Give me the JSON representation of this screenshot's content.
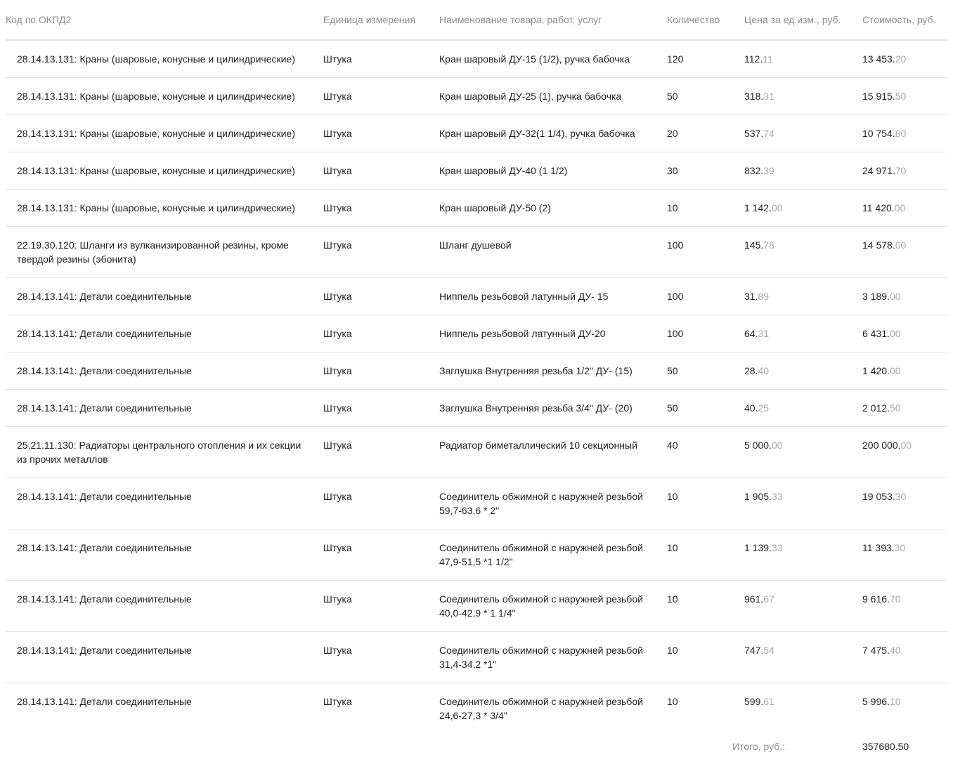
{
  "table": {
    "headers": [
      "Код по ОКПД2",
      "Единица измерения",
      "Наименование товара, работ, услуг",
      "Количество",
      "Цена за ед.изм., руб.",
      "Стоимость, руб."
    ],
    "rows": [
      {
        "code": "28.14.13.131: Краны (шаровые, конусные и цилиндрические)",
        "unit": "Штука",
        "name": "Кран шаровый ДУ-15 (1/2), ручка бабочка",
        "qty": "120",
        "price_int": "112.",
        "price_dec": "11",
        "cost_int": "13 453.",
        "cost_dec": "20"
      },
      {
        "code": "28.14.13.131: Краны (шаровые, конусные и цилиндрические)",
        "unit": "Штука",
        "name": "Кран шаровый ДУ-25 (1), ручка бабочка",
        "qty": "50",
        "price_int": "318.",
        "price_dec": "31",
        "cost_int": "15 915.",
        "cost_dec": "50"
      },
      {
        "code": "28.14.13.131: Краны (шаровые, конусные и цилиндрические)",
        "unit": "Штука",
        "name": "Кран шаровый ДУ-32(1 1/4), ручка бабочка",
        "qty": "20",
        "price_int": "537.",
        "price_dec": "74",
        "cost_int": "10 754.",
        "cost_dec": "80"
      },
      {
        "code": "28.14.13.131: Краны (шаровые, конусные и цилиндрические)",
        "unit": "Штука",
        "name": "Кран шаровый ДУ-40 (1 1/2)",
        "qty": "30",
        "price_int": "832.",
        "price_dec": "39",
        "cost_int": "24 971.",
        "cost_dec": "70"
      },
      {
        "code": "28.14.13.131: Краны (шаровые, конусные и цилиндрические)",
        "unit": "Штука",
        "name": "Кран шаровый ДУ-50 (2)",
        "qty": "10",
        "price_int": "1 142.",
        "price_dec": "00",
        "cost_int": "11 420.",
        "cost_dec": "00"
      },
      {
        "code": "22.19.30.120: Шланги из вулканизированной резины, кроме твердой резины (эбонита)",
        "unit": "Штука",
        "name": "Шланг душевой",
        "qty": "100",
        "price_int": "145.",
        "price_dec": "78",
        "cost_int": "14 578.",
        "cost_dec": "00"
      },
      {
        "code": "28.14.13.141: Детали соединительные",
        "unit": "Штука",
        "name": "Ниппель резьбовой латунный ДУ- 15",
        "qty": "100",
        "price_int": "31.",
        "price_dec": "89",
        "cost_int": "3 189.",
        "cost_dec": "00"
      },
      {
        "code": "28.14.13.141: Детали соединительные",
        "unit": "Штука",
        "name": "Ниппель резьбовой латунный ДУ-20",
        "qty": "100",
        "price_int": "64.",
        "price_dec": "31",
        "cost_int": "6 431.",
        "cost_dec": "00"
      },
      {
        "code": "28.14.13.141: Детали соединительные",
        "unit": "Штука",
        "name": "Заглушка Внутренняя резьба 1/2\" ДУ- (15)",
        "qty": "50",
        "price_int": "28.",
        "price_dec": "40",
        "cost_int": "1 420.",
        "cost_dec": "00"
      },
      {
        "code": "28.14.13.141: Детали соединительные",
        "unit": "Штука",
        "name": "Заглушка Внутренняя резьба 3/4\" ДУ- (20)",
        "qty": "50",
        "price_int": "40.",
        "price_dec": "25",
        "cost_int": "2 012.",
        "cost_dec": "50"
      },
      {
        "code": "25.21.11.130: Радиаторы центрального отопления и их секции из прочих металлов",
        "unit": "Штука",
        "name": "Радиатор биметаллический 10 секционный",
        "qty": "40",
        "price_int": "5 000.",
        "price_dec": "00",
        "cost_int": "200 000.",
        "cost_dec": "00"
      },
      {
        "code": "28.14.13.141: Детали соединительные",
        "unit": "Штука",
        "name": "Соединитель обжимной с наружней резьбой 59,7-63,6 * 2\"",
        "qty": "10",
        "price_int": "1 905.",
        "price_dec": "33",
        "cost_int": "19 053.",
        "cost_dec": "30"
      },
      {
        "code": "28.14.13.141: Детали соединительные",
        "unit": "Штука",
        "name": "Соединитель обжимной с наружней резьбой 47,9-51,5 *1 1/2\"",
        "qty": "10",
        "price_int": "1 139.",
        "price_dec": "33",
        "cost_int": "11 393.",
        "cost_dec": "30"
      },
      {
        "code": "28.14.13.141: Детали соединительные",
        "unit": "Штука",
        "name": "Соединитель обжимной с наружней резьбой 40,0-42,9 * 1 1/4\"",
        "qty": "10",
        "price_int": "961.",
        "price_dec": "67",
        "cost_int": "9 616.",
        "cost_dec": "70"
      },
      {
        "code": "28.14.13.141: Детали соединительные",
        "unit": "Штука",
        "name": "Соединитель обжимной с наружней резьбой 31,4-34,2 *1\"",
        "qty": "10",
        "price_int": "747.",
        "price_dec": "54",
        "cost_int": "7 475.",
        "cost_dec": "40"
      },
      {
        "code": "28.14.13.141: Детали соединительные",
        "unit": "Штука",
        "name": "Соединитель обжимной с наружней резьбой 24,6-27,3 * 3/4\"",
        "qty": "10",
        "price_int": "599.",
        "price_dec": "61",
        "cost_int": "5 996.",
        "cost_dec": "10"
      }
    ]
  },
  "total": {
    "label": "Итого, руб.:",
    "value": "357680.50"
  }
}
